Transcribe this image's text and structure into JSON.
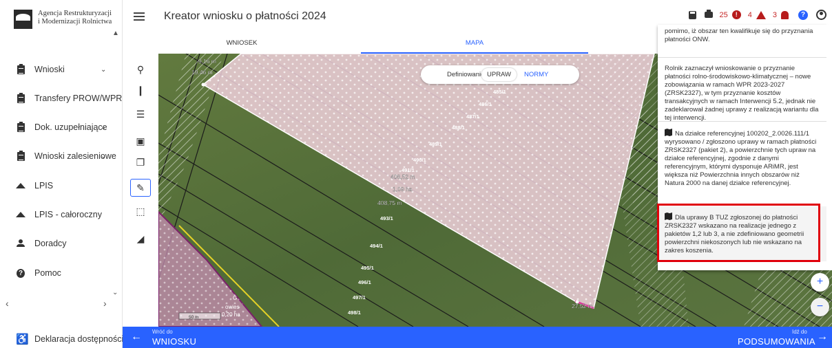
{
  "logo": {
    "line1": "Agencja Restrukturyzacji",
    "line2": "i Modernizacji Rolnictwa"
  },
  "sidebar": {
    "items": [
      {
        "label": "Wnioski",
        "icon": "clipboard-icon",
        "chevron": true
      },
      {
        "label": "Transfery PROW/WPR",
        "icon": "clipboard-icon",
        "chevron": false
      },
      {
        "label": "Dok. uzupełniające",
        "icon": "clipboard-icon",
        "chevron": true
      },
      {
        "label": "Wnioski zalesieniowe",
        "icon": "clipboard-icon",
        "chevron": true
      },
      {
        "label": "LPIS",
        "icon": "mountain-icon",
        "chevron": false
      },
      {
        "label": "LPIS - całoroczny",
        "icon": "mountain-icon",
        "chevron": false
      },
      {
        "label": "Doradcy",
        "icon": "person-icon",
        "chevron": false
      },
      {
        "label": "Pomoc",
        "icon": "help-icon",
        "chevron": false
      }
    ],
    "accessibility": "Deklaracja dostępności"
  },
  "header": {
    "title": "Kreator wniosku o płatności 2024",
    "count_info": "25",
    "count_errors": "4",
    "count_warnings": "3"
  },
  "tabs": [
    {
      "label": "WNIOSEK",
      "active": false
    },
    {
      "label": "MAPA",
      "active": true
    }
  ],
  "map": {
    "mode_label": "Definiowanie",
    "mode_options": [
      "UPRAW",
      "NORMY"
    ],
    "active_mode": "UPRAW",
    "parcel_labels": [
      "485/1",
      "486/1",
      "487/1",
      "488/1",
      "489/1",
      "490/1",
      "491/1",
      "493/1",
      "494/1",
      "495/1",
      "496/1",
      "497/1",
      "498/1"
    ],
    "measurements": [
      "9,16 m",
      "19,46 m",
      "408,52 m",
      "1,09 ha",
      "408,75 m",
      "27,52 m"
    ],
    "area_label_1": "G",
    "area_label_2": "owies",
    "area_label_3": "0,20 ha",
    "scale": "50 m",
    "colors": {
      "accent": "#2962ff",
      "error": "#b71c1c",
      "highlight": "#e0000b"
    }
  },
  "panel": {
    "block1": "pomimo, iż obszar ten kwalifikuje się do przyznania płatności ONW.",
    "block2": "Rolnik zaznaczył wnioskowanie o przyznanie płatności rolno-środowiskowo-klimatycznej – nowe zobowiązania w ramach WPR 2023-2027 (ZRSK2327), w tym przyznanie kosztów transakcyjnych w ramach Interwencji 5.2, jednak nie zadeklarował żadnej uprawy z realizacją wariantu dla tej interwencji.",
    "block3": "Na działce referencyjnej 100202_2.0026.111/1 wyrysowano / zgłoszono uprawy w ramach płatności ZRSK2327 (pakiet 2), a powierzchnie tych upraw na działce referencyjnej, zgodnie z danymi referencyjnym, którymi dysponuje ARiMR, jest większa niż Powierzchnia innych obszarów niż Natura 2000 na danej działce referencyjnej.",
    "block4": "Dla uprawy B TUZ zgłoszonej do płatności ZRSK2327 wskazano na realizacje jednego z pakietów 1,2 lub 3, a nie zdefiniowano geometrii powierzchni niekoszonych lub nie wskazano na zakres koszenia."
  },
  "zoom": {
    "plus": "+",
    "minus": "−"
  },
  "bottom": {
    "back_small": "Wróć do",
    "back_big": "WNIOSKU",
    "next_small": "Idź do",
    "next_big": "PODSUMOWANIA"
  }
}
